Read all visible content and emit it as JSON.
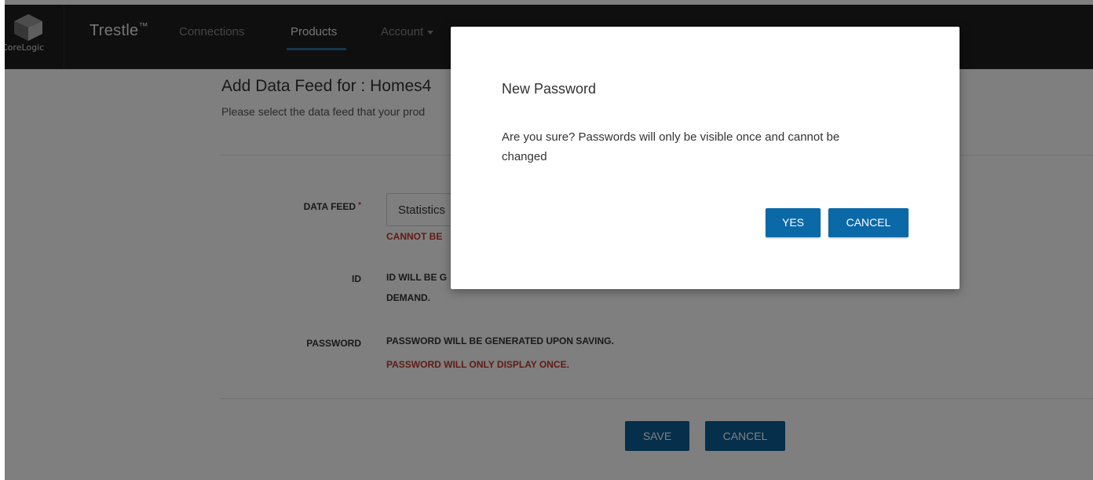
{
  "brand": {
    "logo_text": "CoreLogic",
    "name": "Trestle",
    "tm": "™"
  },
  "nav": {
    "items": [
      {
        "label": "Connections"
      },
      {
        "label": "Products"
      },
      {
        "label": "Account"
      }
    ]
  },
  "page": {
    "title": "Add Data Feed for : Homes4",
    "subtitle": "Please select the data feed that your prod",
    "form": {
      "data_feed_label": "DATA FEED",
      "required_marker": "*",
      "data_feed_value": "Statistics",
      "data_feed_error": "CANNOT BE",
      "id_label": "ID",
      "id_msg_line1": "ID WILL BE G",
      "id_msg_line2": "DEMAND.",
      "password_label": "PASSWORD",
      "password_msg": "PASSWORD WILL BE GENERATED UPON SAVING.",
      "password_warning": "PASSWORD WILL ONLY DISPLAY ONCE."
    },
    "actions": {
      "save_label": "SAVE",
      "cancel_label": "CANCEL"
    }
  },
  "modal": {
    "title": "New Password",
    "body": "Are you sure? Passwords will only be visible once and cannot be changed",
    "yes_label": "YES",
    "cancel_label": "CANCEL"
  },
  "colors": {
    "navbar": "#1f1f1f",
    "accent": "#0b69a8",
    "error": "#c0392b"
  }
}
